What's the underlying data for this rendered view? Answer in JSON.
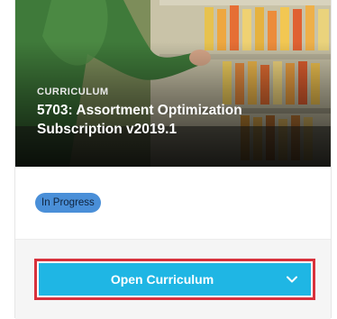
{
  "card": {
    "category": "CURRICULUM",
    "title": "5703: Assortment Optimization Subscription v2019.1",
    "status": "In Progress",
    "status_color": "#4a8fd8",
    "action_label": "Open Curriculum",
    "action_color": "#1fb6e4",
    "highlight_color": "#d8323c",
    "action_icon": "chevron-down-icon",
    "hero_image": "shopper-at-beverage-shelf"
  }
}
